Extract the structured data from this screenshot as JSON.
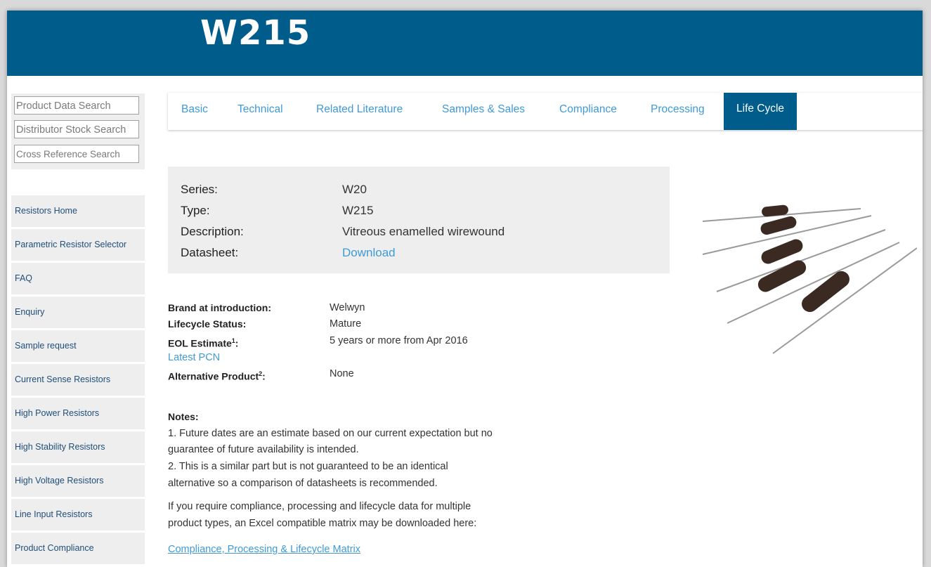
{
  "header": {
    "title": "W215"
  },
  "search": {
    "product": "Product Data Search",
    "distributor": "Distributor Stock Search",
    "cross": "Cross Reference Search"
  },
  "nav": [
    "Resistors Home",
    "Parametric Resistor Selector",
    "FAQ",
    "Enquiry",
    "Sample request",
    "Current Sense Resistors",
    "High Power Resistors",
    "High Stability Resistors",
    "High Voltage Resistors",
    "Line Input Resistors",
    "Product Compliance"
  ],
  "tabs": [
    {
      "label": "Basic",
      "active": false
    },
    {
      "label": "Technical",
      "active": false
    },
    {
      "label": "Related Literature",
      "active": false
    },
    {
      "label": "Samples & Sales",
      "active": false
    },
    {
      "label": "Compliance",
      "active": false
    },
    {
      "label": "Processing",
      "active": false
    },
    {
      "label": "Life Cycle",
      "active": true
    }
  ],
  "info": {
    "series_label": "Series:",
    "series": "W20",
    "type_label": "Type:",
    "type": "W215",
    "desc_label": "Description:",
    "desc": "Vitreous enamelled wirewound",
    "datasheet_label": "Datasheet:",
    "datasheet": "Download"
  },
  "lifecycle": {
    "brand_label": "Brand at introduction:",
    "brand": "Welwyn",
    "status_label": "Lifecycle Status:",
    "status": "Mature",
    "eol_label": "EOL Estimate",
    "eol_sup": "1",
    "eol_colon": ":",
    "eol": "5 years or more from Apr 2016",
    "pcn": "Latest PCN",
    "alt_label": "Alternative Product",
    "alt_sup": "2",
    "alt_colon": ":",
    "alt": "None"
  },
  "notes": {
    "head": "Notes:",
    "lines": [
      "1. Future dates are an estimate based on our current expectation but no",
      "guarantee of future availability is intended.",
      "2. This is a similar part but is not guaranteed to be an identical",
      "alternative so a comparison of datasheets is recommended."
    ],
    "excel_lines": [
      "If you require compliance, processing and lifecycle data for multiple",
      "product types, an Excel compatible matrix may be downloaded here:"
    ],
    "matrix_link": "Compliance, Processing & Lifecycle Matrix"
  },
  "colors": {
    "brand_blue": "#005c8a",
    "link_blue": "#3f9ad6",
    "panel_gray": "#eeeeee"
  }
}
